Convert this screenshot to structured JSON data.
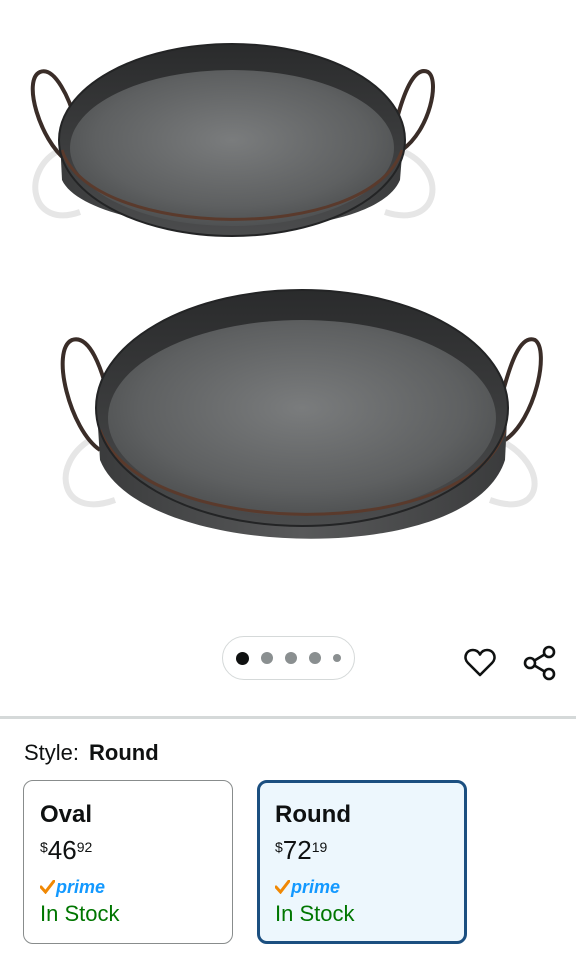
{
  "product": {
    "image_alt": "Set of two galvanized metal serving trays with handles",
    "carousel": {
      "count": 5,
      "active_index": 0
    }
  },
  "actions": {
    "favorite_icon": "heart-icon",
    "share_icon": "share-icon"
  },
  "style_selector": {
    "label": "Style:",
    "selected": "Round",
    "options": [
      {
        "name": "Oval",
        "price_symbol": "$",
        "price_whole": "46",
        "price_fraction": "92",
        "prime": "prime",
        "availability": "In Stock"
      },
      {
        "name": "Round",
        "price_symbol": "$",
        "price_whole": "72",
        "price_fraction": "19",
        "prime": "prime",
        "availability": "In Stock"
      }
    ]
  },
  "colors": {
    "selected_border": "#1B4F80",
    "selected_bg": "#EDF7FD",
    "prime_blue": "#1399FF",
    "prime_check": "#F08804",
    "in_stock_green": "#007600"
  }
}
